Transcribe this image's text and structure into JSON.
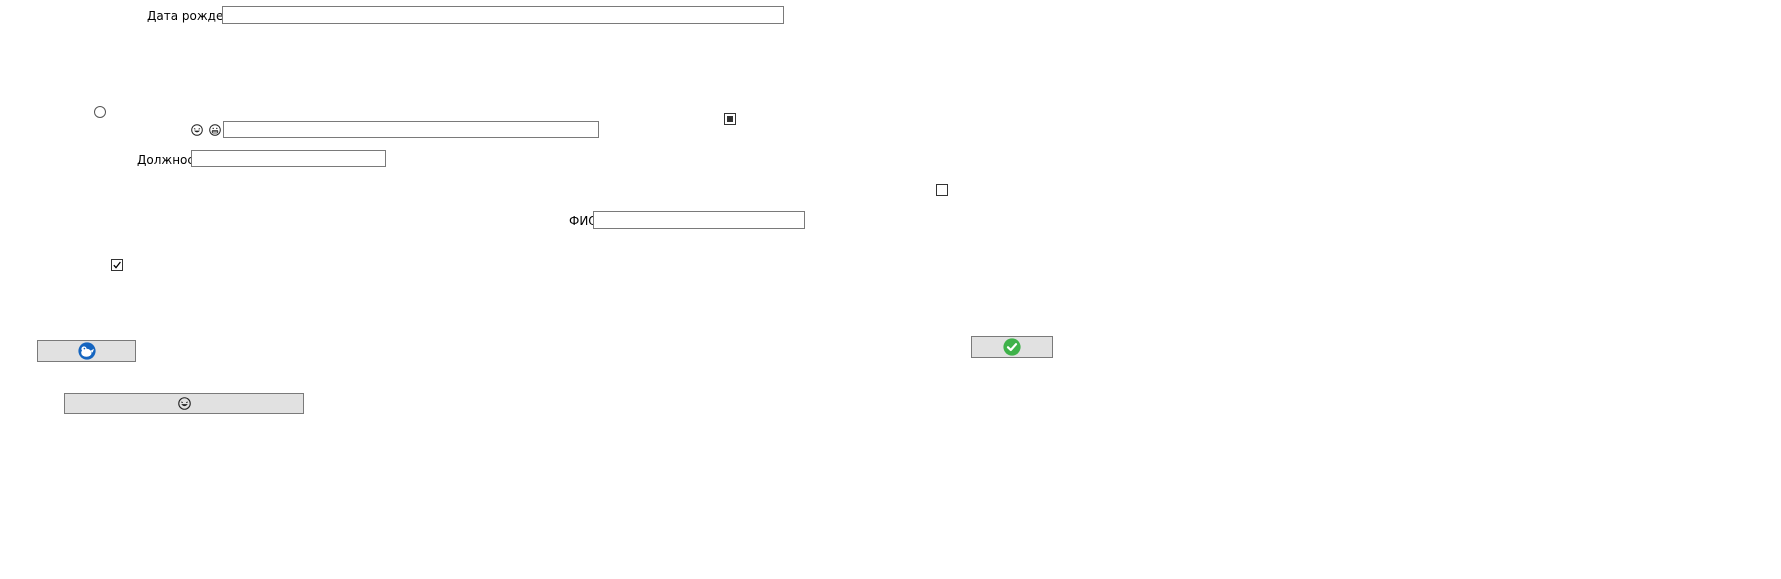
{
  "form": {
    "birth_date_label": "Дата рождения",
    "birth_date_value": "",
    "unlabeled_field_value": "",
    "position_label": "Должность",
    "position_value": "",
    "fio_label": "ФИО",
    "fio_value": ""
  },
  "controls": {
    "radio_selected": false,
    "checkbox_indeterminate": true,
    "checkbox_empty": false,
    "checkbox_checked": true
  },
  "icons": {
    "field_prefix_icons": [
      "laughing-face-icon",
      "grinning-face-icon"
    ],
    "button_left": "penguin-logo-icon",
    "button_right": "green-check-icon",
    "button_wide": "laughing-face-icon"
  },
  "colors": {
    "button_bg": "#e1e1e1",
    "border": "#7a7a7a",
    "check_green": "#3fb24a",
    "logo_blue": "#1565c0"
  }
}
